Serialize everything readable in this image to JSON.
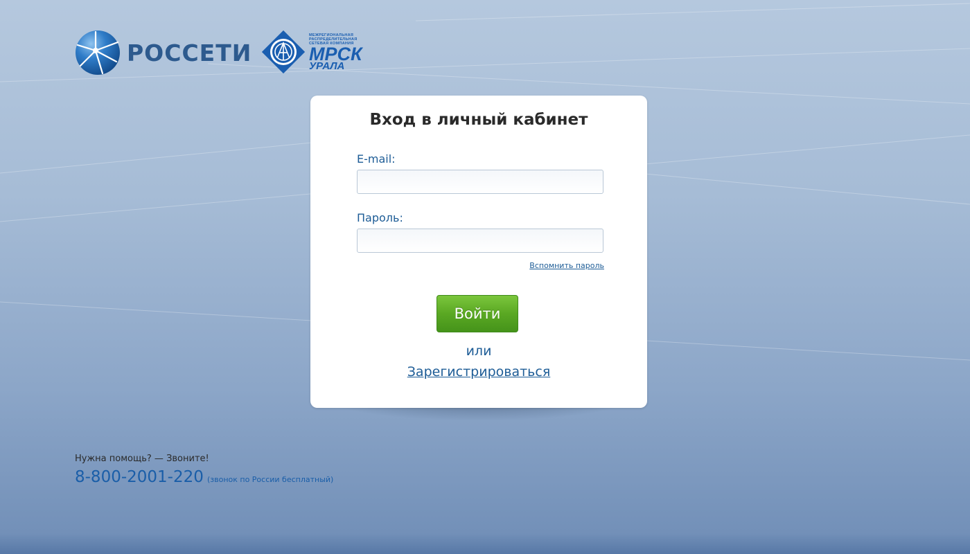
{
  "brand": {
    "rosseti_name": "РОССЕТИ",
    "mrsk_small_line1": "Межрегиональная",
    "mrsk_small_line2": "распределительная",
    "mrsk_small_line3": "сетевая компания",
    "mrsk_name": "МРСК",
    "mrsk_region": "УРАЛА",
    "colors": {
      "rosseti_text": "#2d5a8e",
      "mrsk_blue": "#1a5eb0"
    }
  },
  "login_form": {
    "title": "Вход в личный кабинет",
    "email_label": "E-mail:",
    "email_value": "",
    "password_label": "Пароль:",
    "password_value": "",
    "forgot_password": "Вспомнить пароль",
    "submit_label": "Войти",
    "or_text": "или",
    "register_label": "Зарегистрироваться",
    "colors": {
      "label": "#1d5c96",
      "button_green": "#5aa823"
    }
  },
  "help": {
    "question": "Нужна помощь? — Звоните!",
    "phone": "8-800-2001-220",
    "phone_note": "(звонок по России бесплатный)"
  }
}
